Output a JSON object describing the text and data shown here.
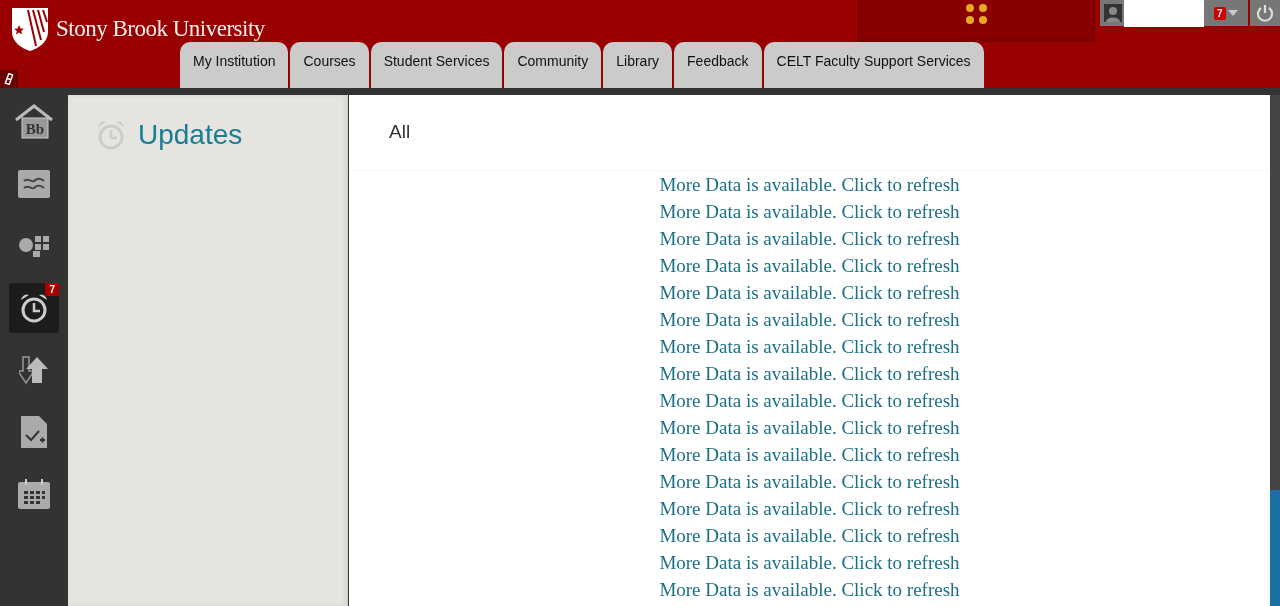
{
  "header": {
    "logo_text": "Stony Brook University",
    "user_badge": "7"
  },
  "tabs": [
    {
      "label": "My Institution"
    },
    {
      "label": "Courses"
    },
    {
      "label": "Student Services"
    },
    {
      "label": "Community"
    },
    {
      "label": "Library"
    },
    {
      "label": "Feedback"
    },
    {
      "label": "CELT Faculty Support Services"
    }
  ],
  "nav_items": [
    {
      "kind": "home",
      "selected": false,
      "label": "Bb"
    },
    {
      "kind": "stream",
      "selected": false
    },
    {
      "kind": "tools",
      "selected": false
    },
    {
      "kind": "updates",
      "selected": true,
      "badge": "7"
    },
    {
      "kind": "transfer",
      "selected": false
    },
    {
      "kind": "grades",
      "selected": false
    },
    {
      "kind": "calendar",
      "selected": false
    }
  ],
  "panel": {
    "title": "Updates"
  },
  "main": {
    "filter": "All",
    "refresh_links": [
      "More Data is available. Click to refresh",
      "More Data is available. Click to refresh",
      "More Data is available. Click to refresh",
      "More Data is available. Click to refresh",
      "More Data is available. Click to refresh",
      "More Data is available. Click to refresh",
      "More Data is available. Click to refresh",
      "More Data is available. Click to refresh",
      "More Data is available. Click to refresh",
      "More Data is available. Click to refresh",
      "More Data is available. Click to refresh",
      "More Data is available. Click to refresh",
      "More Data is available. Click to refresh",
      "More Data is available. Click to refresh",
      "More Data is available. Click to refresh",
      "More Data is available. Click to refresh"
    ]
  }
}
